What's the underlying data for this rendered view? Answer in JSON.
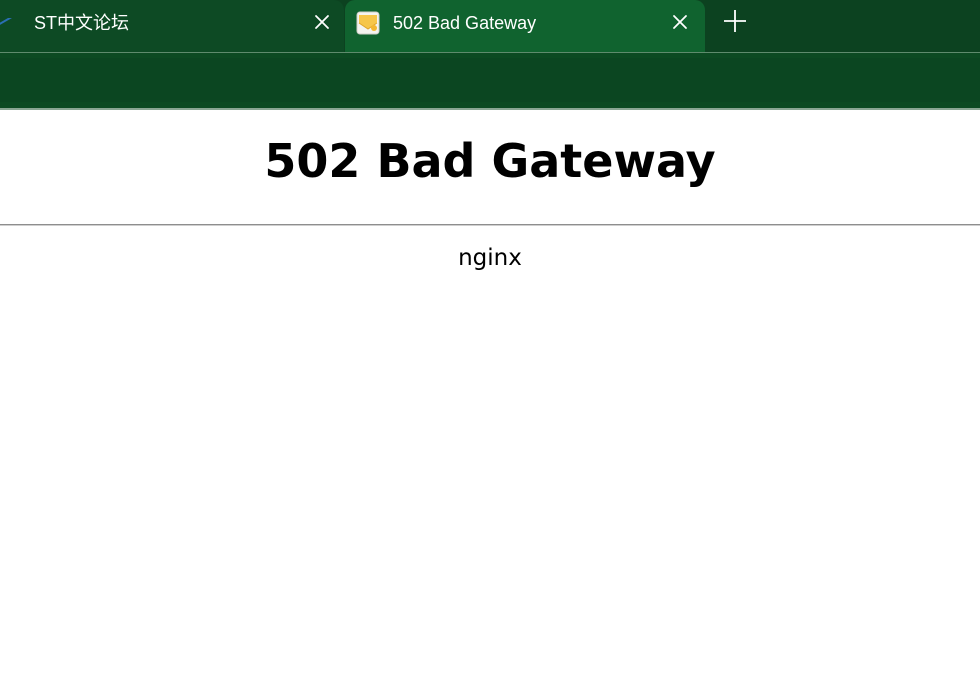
{
  "browser": {
    "tabs": [
      {
        "title": "ST中文论坛",
        "favicon": "st-logo-icon",
        "active": false
      },
      {
        "title": "502 Bad Gateway",
        "favicon": "envelope-icon",
        "active": true
      }
    ],
    "new_tab_icon": "plus-icon",
    "close_icon": "close-icon",
    "colors": {
      "tabstrip": "#0c4220",
      "active_tab": "#10632f",
      "toolbar": "#0c4a22"
    }
  },
  "page": {
    "heading": "502 Bad Gateway",
    "server": "nginx"
  }
}
